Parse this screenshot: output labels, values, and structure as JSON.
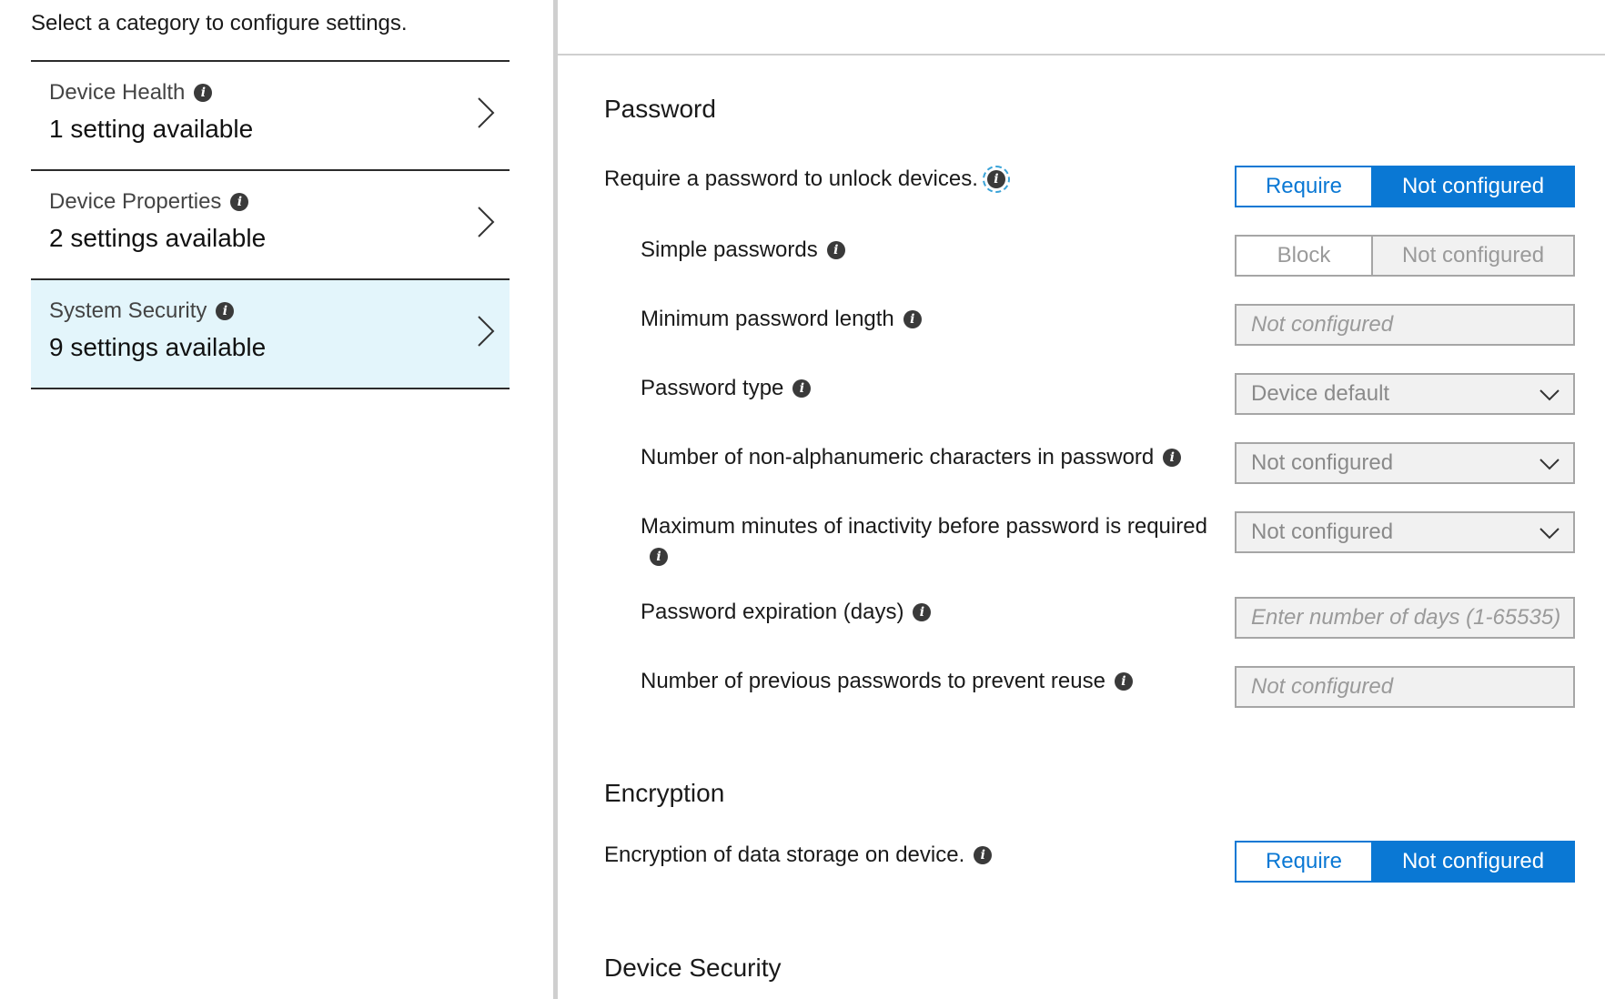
{
  "left": {
    "intro": "Select a category to configure settings.",
    "categories": [
      {
        "title": "Device Health",
        "count": "1 setting available"
      },
      {
        "title": "Device Properties",
        "count": "2 settings available"
      },
      {
        "title": "System Security",
        "count": "9 settings available"
      }
    ]
  },
  "password": {
    "title": "Password",
    "require": {
      "label": "Require a password to unlock devices.",
      "option_a": "Require",
      "option_b": "Not configured"
    },
    "simple": {
      "label": "Simple passwords",
      "option_a": "Block",
      "option_b": "Not configured"
    },
    "min_length": {
      "label": "Minimum password length",
      "placeholder": "Not configured"
    },
    "type": {
      "label": "Password type",
      "value": "Device default"
    },
    "non_alnum": {
      "label": "Number of non-alphanumeric characters in password",
      "value": "Not configured"
    },
    "inactivity": {
      "label": "Maximum minutes of inactivity before password is required",
      "value": "Not configured"
    },
    "expiration": {
      "label": "Password expiration (days)",
      "placeholder": "Enter number of days (1-65535)"
    },
    "reuse": {
      "label": "Number of previous passwords to prevent reuse",
      "placeholder": "Not configured"
    }
  },
  "encryption": {
    "title": "Encryption",
    "storage": {
      "label": "Encryption of data storage on device.",
      "option_a": "Require",
      "option_b": "Not configured"
    }
  },
  "device_security": {
    "title": "Device Security"
  },
  "colors": {
    "accent": "#0a78d4",
    "selected_bg": "#e3f5fb"
  },
  "icons": {
    "info": "info-icon",
    "chevron": "chevron-right-icon",
    "dropdown": "chevron-down-icon"
  }
}
